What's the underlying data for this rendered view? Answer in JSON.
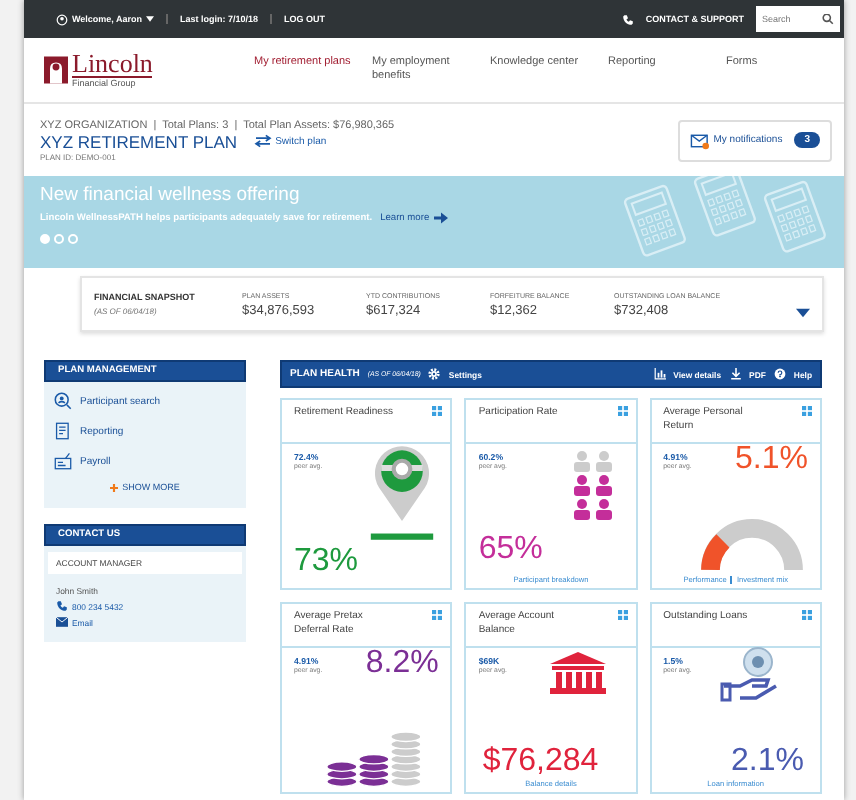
{
  "top_bar": {
    "welcome": "Welcome, Aaron",
    "last_login": "Last login: 7/10/18",
    "logout": "LOG OUT",
    "contact": "CONTACT & SUPPORT",
    "search_placeholder": "Search"
  },
  "logo": {
    "name": "Lincoln",
    "sub": "Financial Group"
  },
  "nav": [
    {
      "label": "My retirement plans",
      "selected": true
    },
    {
      "label": "My employment benefits",
      "selected": false
    },
    {
      "label": "Knowledge center",
      "selected": false
    },
    {
      "label": "Reporting",
      "selected": false
    },
    {
      "label": "Forms",
      "selected": false
    }
  ],
  "plan_header": {
    "org_line": "XYZ ORGANIZATION  |  Total Plans: 3  |  Total Plan Assets: $76,980,365",
    "plan_name": "XYZ RETIREMENT PLAN",
    "switch_plan": "Switch plan",
    "plan_id": "PLAN ID: DEMO-001",
    "notifications": "My notifications",
    "notification_count": "3"
  },
  "banner": {
    "title": "New financial wellness offering",
    "text": "Lincoln WellnessPATH helps participants adequately save for retirement.",
    "link": "Learn more",
    "dots": [
      {
        "selected": true
      },
      {
        "selected": false
      },
      {
        "selected": false
      }
    ]
  },
  "snapshot": {
    "title": "FINANCIAL SNAPSHOT",
    "as_of": "(AS OF 06/04/18)",
    "metrics": [
      {
        "label": "PLAN ASSETS",
        "value": "$34,876,593"
      },
      {
        "label": "YTD CONTRIBUTIONS",
        "value": "$617,324"
      },
      {
        "label": "FORFEITURE BALANCE",
        "value": "$12,362"
      },
      {
        "label": "OUTSTANDING LOAN BALANCE",
        "value": "$732,408"
      }
    ]
  },
  "plan_management": {
    "title": "PLAN MANAGEMENT",
    "items": [
      {
        "label": "Participant search",
        "kind": "search"
      },
      {
        "label": "Reporting",
        "kind": "report"
      },
      {
        "label": "Payroll",
        "kind": "payroll"
      }
    ],
    "show_more": "SHOW MORE"
  },
  "contact": {
    "title": "CONTACT US",
    "role": "ACCOUNT MANAGER",
    "name": "John Smith",
    "phone": "800 234 5432",
    "email": "Email"
  },
  "plan_health": {
    "title": "PLAN HEALTH",
    "as_of": "(AS OF 06/04/18)",
    "settings": "Settings",
    "actions": [
      {
        "label": "View details",
        "kind": "chart"
      },
      {
        "label": "PDF",
        "kind": "download"
      },
      {
        "label": "Help",
        "kind": "help"
      }
    ]
  },
  "cards": [
    {
      "title": "Retirement Readiness",
      "peer_value": "72.4%",
      "peer_label": "peer avg.",
      "value": "73%",
      "color": "#1e9a3e",
      "kind": "pin"
    },
    {
      "title": "Participation Rate",
      "peer_value": "60.2%",
      "peer_label": "peer avg.",
      "value": "65%",
      "color": "#c42e9a",
      "kind": "people",
      "links": [
        "Participant breakdown"
      ]
    },
    {
      "title": "Average Personal Return",
      "peer_value": "4.91%",
      "peer_label": "peer avg.",
      "value": "5.1%",
      "color": "#f0532a",
      "kind": "gauge",
      "links": [
        "Performance",
        "Investment mix"
      ]
    },
    {
      "title": "Average Pretax Deferral Rate",
      "peer_value": "4.91%",
      "peer_label": "peer avg.",
      "value": "8.2%",
      "color": "#7b2f95",
      "kind": "coins"
    },
    {
      "title": "Average Account Balance",
      "peer_value": "$69K",
      "peer_label": "peer avg.",
      "value": "$76,284",
      "color": "#e0233c",
      "kind": "bank",
      "links": [
        "Balance details"
      ]
    },
    {
      "title": "Outstanding Loans",
      "peer_value": "1.5%",
      "peer_label": "peer avg.",
      "value": "2.1%",
      "color": "#4a5bb0",
      "kind": "hand",
      "links": [
        "Loan information"
      ]
    }
  ]
}
